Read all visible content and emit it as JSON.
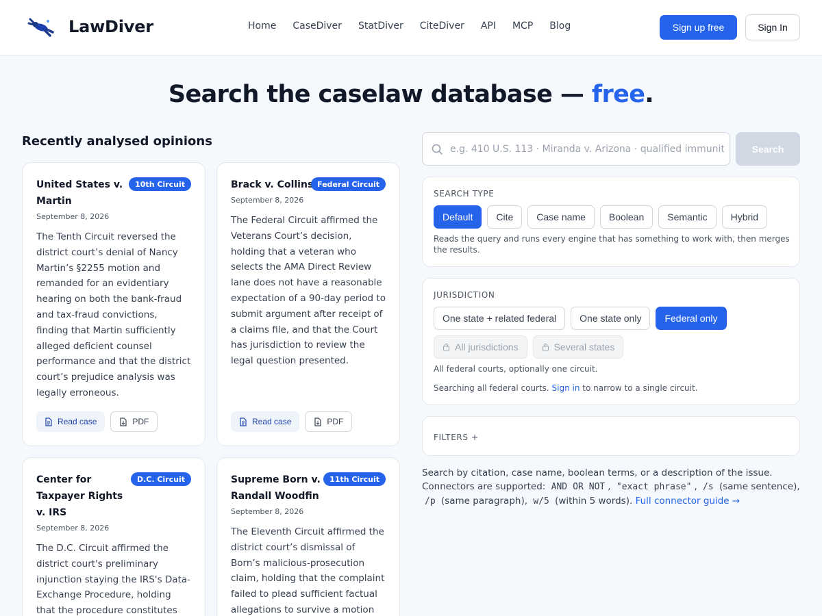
{
  "brand": {
    "name": "LawDiver"
  },
  "nav": [
    "Home",
    "CaseDiver",
    "StatDiver",
    "CiteDiver",
    "API",
    "MCP",
    "Blog"
  ],
  "header_actions": {
    "signup": "Sign up free",
    "signin": "Sign In"
  },
  "hero": {
    "title_prefix": "Search the caselaw database — ",
    "title_accent": "free",
    "title_suffix": "."
  },
  "recent": {
    "title": "Recently analysed opinions",
    "read_label": "Read case",
    "pdf_label": "PDF",
    "cards": [
      {
        "title": "United States v. Martin",
        "court": "10th Circuit",
        "date": "September 8, 2026",
        "summary": "The Tenth Circuit reversed the district court’s denial of Nancy Martin’s §2255 motion and remanded for an evidentiary hearing on both the bank-fraud and tax-fraud convictions, finding that Martin sufficiently alleged deficient counsel performance and that the district court’s prejudice analysis was legally erroneous."
      },
      {
        "title": "Brack v. Collins",
        "court": "Federal Circuit",
        "date": "September 8, 2026",
        "summary": "The Federal Circuit affirmed the Veterans Court’s decision, holding that a veteran who selects the AMA Direct Review lane does not have a reasonable expectation of a 90-day period to submit argument after receipt of a claims file, and that the Court has jurisdiction to review the legal question presented."
      },
      {
        "title": "Center for Taxpayer Rights v. IRS",
        "court": "D.C. Circuit",
        "date": "September 8, 2026",
        "summary": "The D.C. Circuit affirmed the district court's preliminary injunction staying the IRS's Data-Exchange Procedure, holding that the procedure constitutes final"
      },
      {
        "title": "Supreme Born v. Randall Woodfin",
        "court": "11th Circuit",
        "date": "September 8, 2026",
        "summary": "The Eleventh Circuit affirmed the district court’s dismissal of Born’s malicious-prosecution claim, holding that the complaint failed to plead sufficient factual allegations to survive a motion to"
      }
    ]
  },
  "search": {
    "placeholder": "e.g. 410 U.S. 113 · Miranda v. Arizona · qualified immunity",
    "value": "",
    "button": "Search"
  },
  "search_type": {
    "label": "SEARCH TYPE",
    "options": [
      "Default",
      "Cite",
      "Case name",
      "Boolean",
      "Semantic",
      "Hybrid"
    ],
    "selected": "Default",
    "description": "Reads the query and runs every engine that has something to work with, then merges the results."
  },
  "jurisdiction": {
    "label": "JURISDICTION",
    "options": [
      "One state + related federal",
      "One state only",
      "Federal only"
    ],
    "selected": "Federal only",
    "locked_options": [
      "All jurisdictions",
      "Several states"
    ],
    "note": "All federal courts, optionally one circuit.",
    "signin_prefix": "Searching all federal courts. ",
    "signin_link": "Sign in",
    "signin_suffix": " to narrow to a single circuit."
  },
  "filters": {
    "label": "FILTERS +"
  },
  "help": {
    "line1": "Search by citation, case name, boolean terms, or a description of the issue.",
    "connectors_label": "Connectors are supported:",
    "and": "AND",
    "or": "OR",
    "not": "NOT",
    "phrase": "\"exact phrase\"",
    "sentence_op": "/s",
    "sentence_desc": "(same sentence),",
    "paragraph_op": "/p",
    "paragraph_desc": "(same paragraph),",
    "within_op": "w/5",
    "within_desc": "(within 5 words).",
    "guide_link": "Full connector guide →"
  },
  "colors": {
    "accent": "#2563eb",
    "muted_button": "#cfd8e3",
    "background": "#f5f8fc"
  }
}
